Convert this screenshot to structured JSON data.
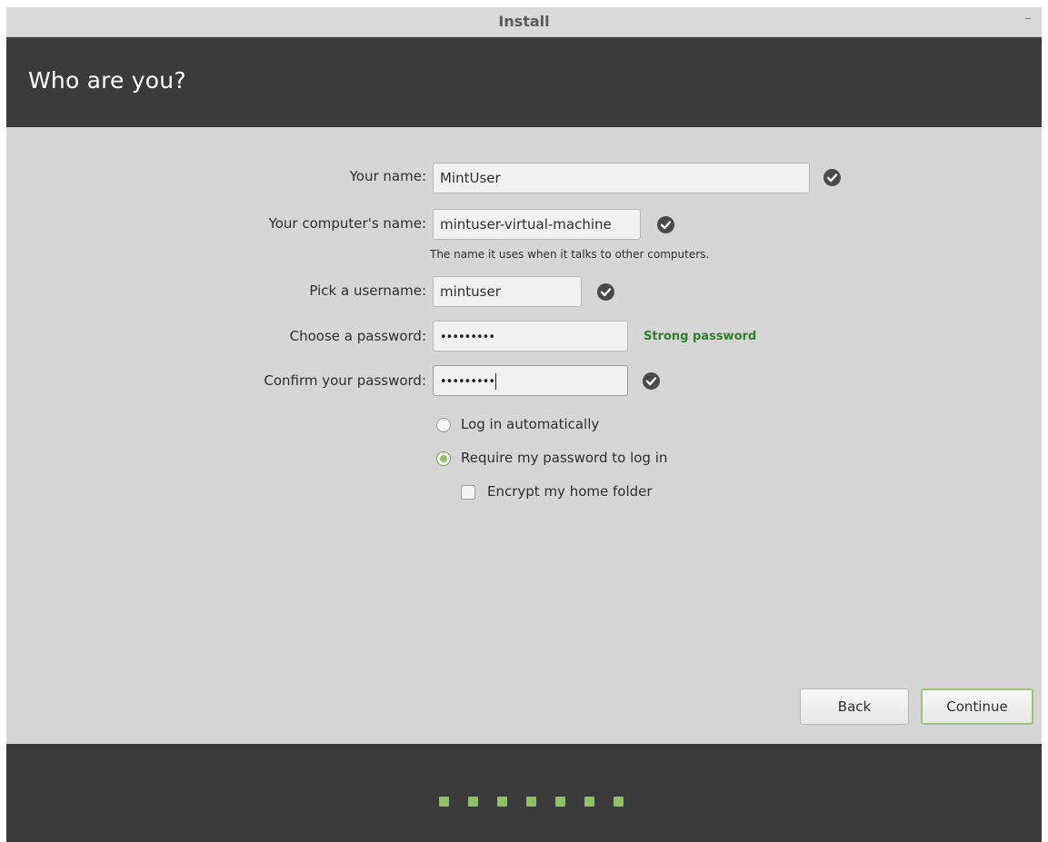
{
  "window": {
    "title": "Install",
    "minimize_glyph": "–"
  },
  "header": {
    "title": "Who are you?"
  },
  "form": {
    "name": {
      "label": "Your name:",
      "value": "MintUser",
      "valid_icon": "check-circle-icon"
    },
    "computer": {
      "label": "Your computer's name:",
      "value": "mintuser-virtual-machine",
      "hint": "The name it uses when it talks to other computers.",
      "valid_icon": "check-circle-icon"
    },
    "username": {
      "label": "Pick a username:",
      "value": "mintuser",
      "valid_icon": "check-circle-icon"
    },
    "password": {
      "label": "Choose a password:",
      "masked": "•••••••••",
      "strength": "Strong password"
    },
    "confirm": {
      "label": "Confirm your password:",
      "masked": "•••••••••",
      "valid_icon": "check-circle-icon"
    }
  },
  "login_options": {
    "auto": {
      "label": "Log in automatically",
      "checked": false
    },
    "require": {
      "label": "Require my password to log in",
      "checked": true
    },
    "encrypt": {
      "label": "Encrypt my home folder",
      "checked": false
    }
  },
  "buttons": {
    "back": "Back",
    "continue": "Continue"
  },
  "progress": {
    "total_steps": 7
  },
  "colors": {
    "accent": "#8fbf6a",
    "strength_text": "#2f7d2f",
    "header_bg": "#3b3b3b",
    "content_bg": "#d6d6d6"
  }
}
